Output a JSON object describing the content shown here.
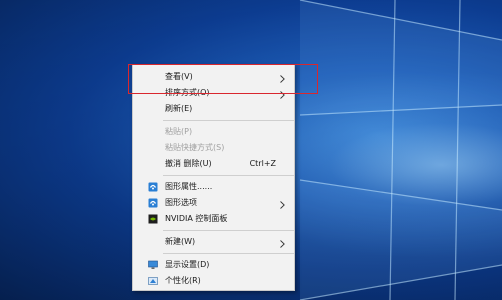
{
  "context_menu": {
    "items": [
      {
        "label": "查看(V)",
        "has_submenu": true
      },
      {
        "label": "排序方式(O)",
        "has_submenu": true
      },
      {
        "label": "刷新(E)"
      },
      {
        "separator": true
      },
      {
        "label": "粘贴(P)",
        "disabled": true
      },
      {
        "label": "粘贴快捷方式(S)",
        "disabled": true
      },
      {
        "label": "撤消 删除(U)",
        "shortcut": "Ctrl+Z"
      },
      {
        "separator": true
      },
      {
        "label": "图形属性......",
        "icon": "intel-graphics-icon"
      },
      {
        "label": "图形选项",
        "icon": "intel-graphics-icon",
        "has_submenu": true
      },
      {
        "label": "NVIDIA 控制面板",
        "icon": "nvidia-icon"
      },
      {
        "separator": true
      },
      {
        "label": "新建(W)",
        "has_submenu": true
      },
      {
        "separator": true
      },
      {
        "label": "显示设置(D)",
        "icon": "display-settings-icon"
      },
      {
        "label": "个性化(R)",
        "icon": "personalize-icon"
      }
    ]
  },
  "colors": {
    "highlight_border": "#d9272e",
    "menu_background": "#f2f2f2",
    "desktop_blue": "#1f63c4"
  }
}
